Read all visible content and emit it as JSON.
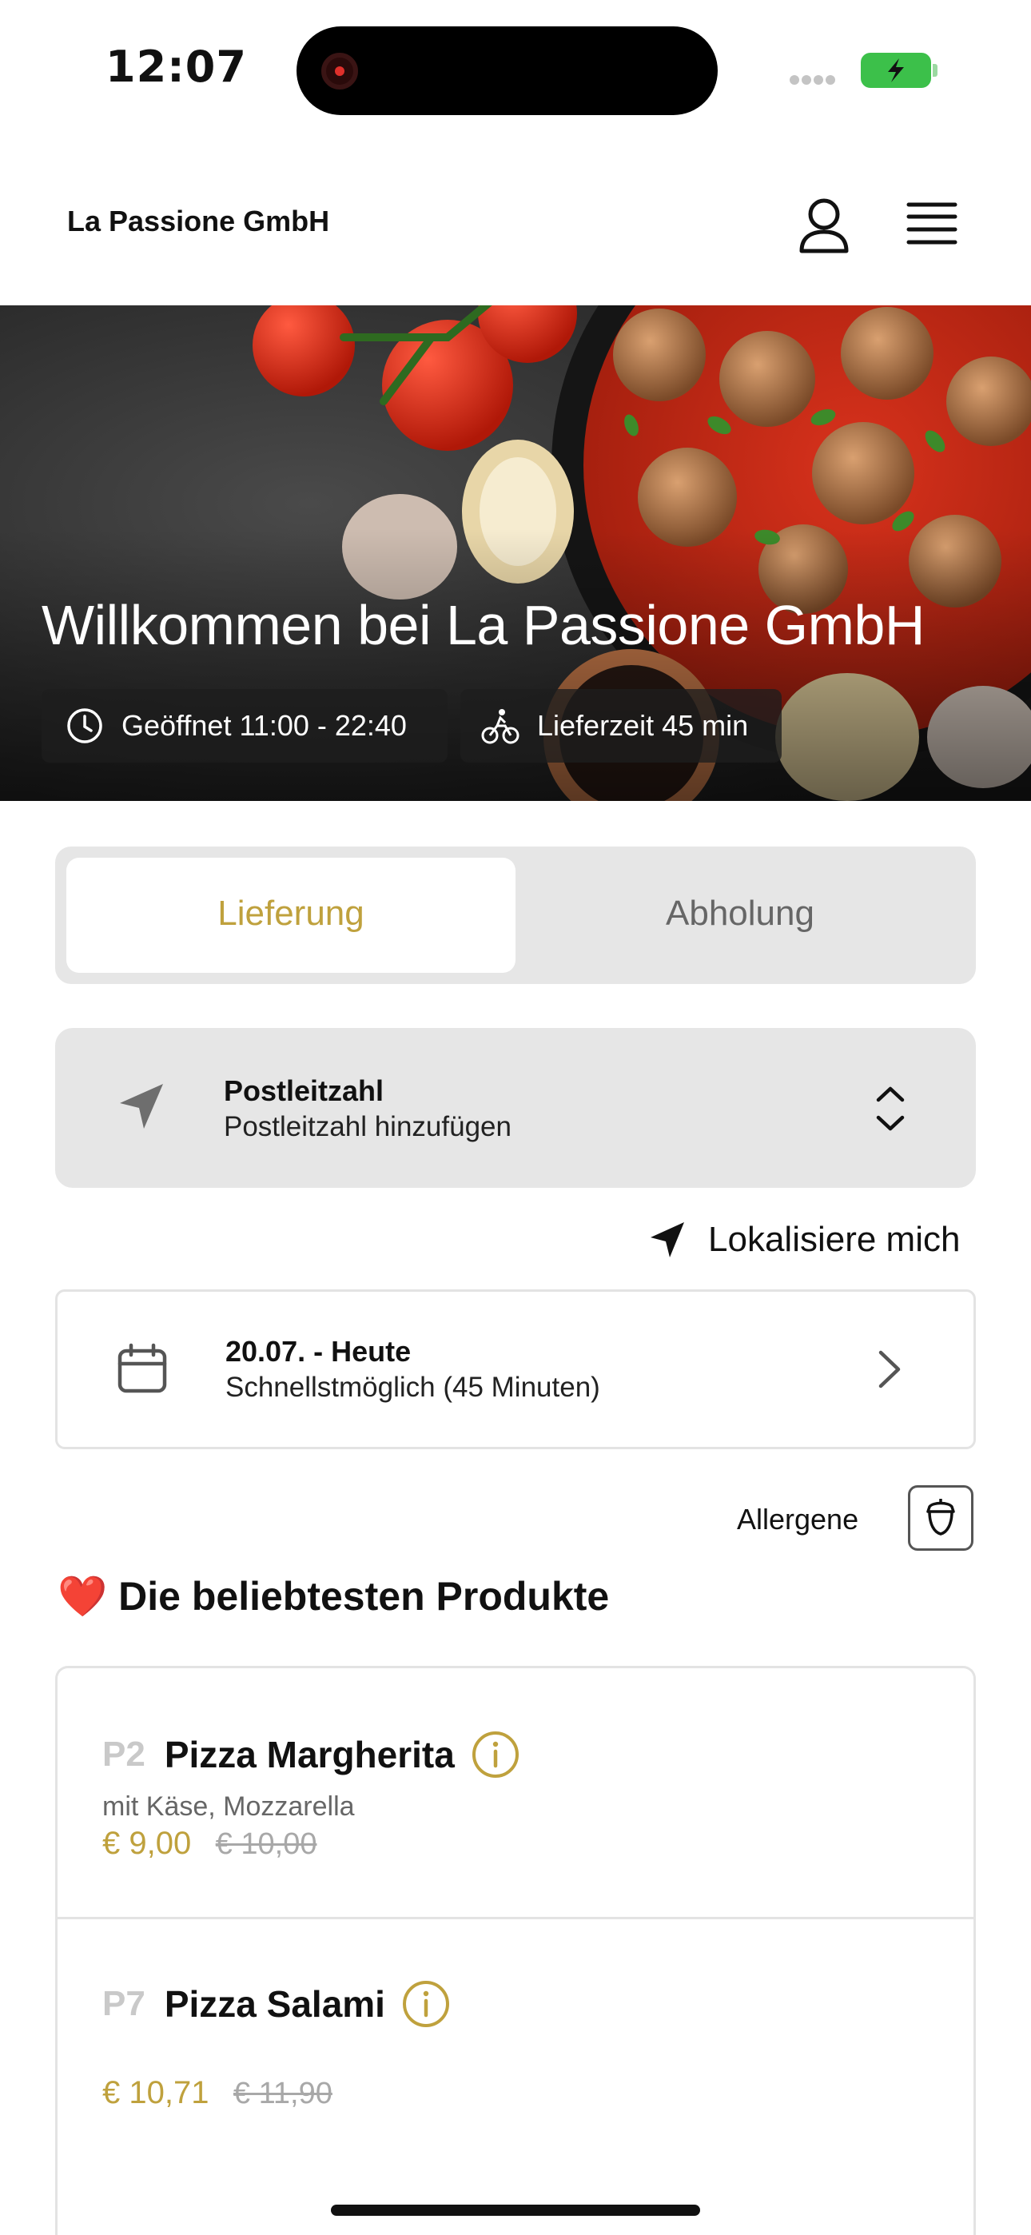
{
  "status_bar": {
    "time": "12:07"
  },
  "header": {
    "brand": "La Passione GmbH"
  },
  "hero": {
    "title": "Willkommen bei La Passione GmbH",
    "opening_hours": "Geöffnet 11:00 - 22:40",
    "delivery_time": "Lieferzeit 45 min"
  },
  "mode_toggle": {
    "options": [
      "Lieferung",
      "Abholung"
    ],
    "selected": "Lieferung"
  },
  "postal": {
    "title": "Postleitzahl",
    "placeholder": "Postleitzahl hinzufügen"
  },
  "locate_label": "Lokalisiere mich",
  "schedule": {
    "date": "20.07. - Heute",
    "time": "Schnellstmöglich (45 Minuten)"
  },
  "allergens_label": "Allergene",
  "popular": {
    "title": "Die beliebtesten Produkte",
    "emoji": "❤️",
    "products": [
      {
        "code": "P2",
        "name": "Pizza Margherita",
        "description": "mit Käse, Mozzarella",
        "price": "€ 9,00",
        "old_price": "€ 10,00"
      },
      {
        "code": "P7",
        "name": "Pizza Salami",
        "description": "",
        "price": "€ 10,71",
        "old_price": "€ 11,90"
      }
    ]
  },
  "colors": {
    "accent": "#bfa13d",
    "toggle_bg": "#e6e6e6",
    "battery": "#3cc04a"
  }
}
